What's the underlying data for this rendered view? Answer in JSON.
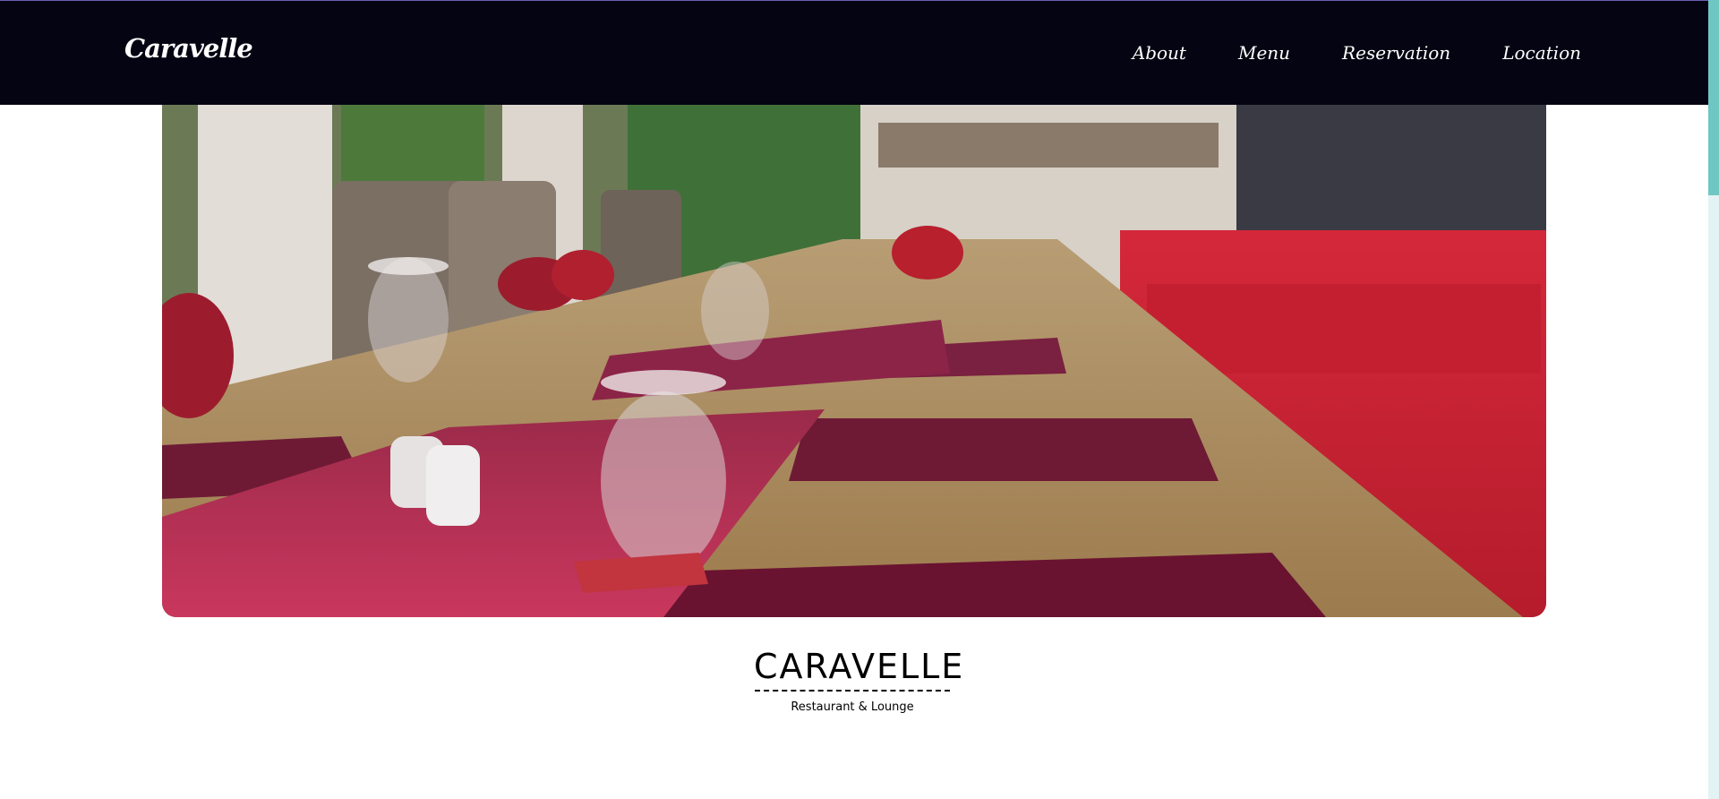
{
  "header": {
    "brand": "Caravelle",
    "nav": [
      {
        "label": "About"
      },
      {
        "label": "Menu"
      },
      {
        "label": "Reservation"
      },
      {
        "label": "Location"
      }
    ]
  },
  "hero": {
    "image_description_icon": "restaurant-photo"
  },
  "logo": {
    "wordmark": "CARAVELLE",
    "tagline": "Restaurant & Lounge"
  },
  "colors": {
    "nav_background": "#050412",
    "nav_text": "#ffffff",
    "scroll_thumb": "#6fc7c4",
    "scroll_track": "#e3f3f3"
  }
}
